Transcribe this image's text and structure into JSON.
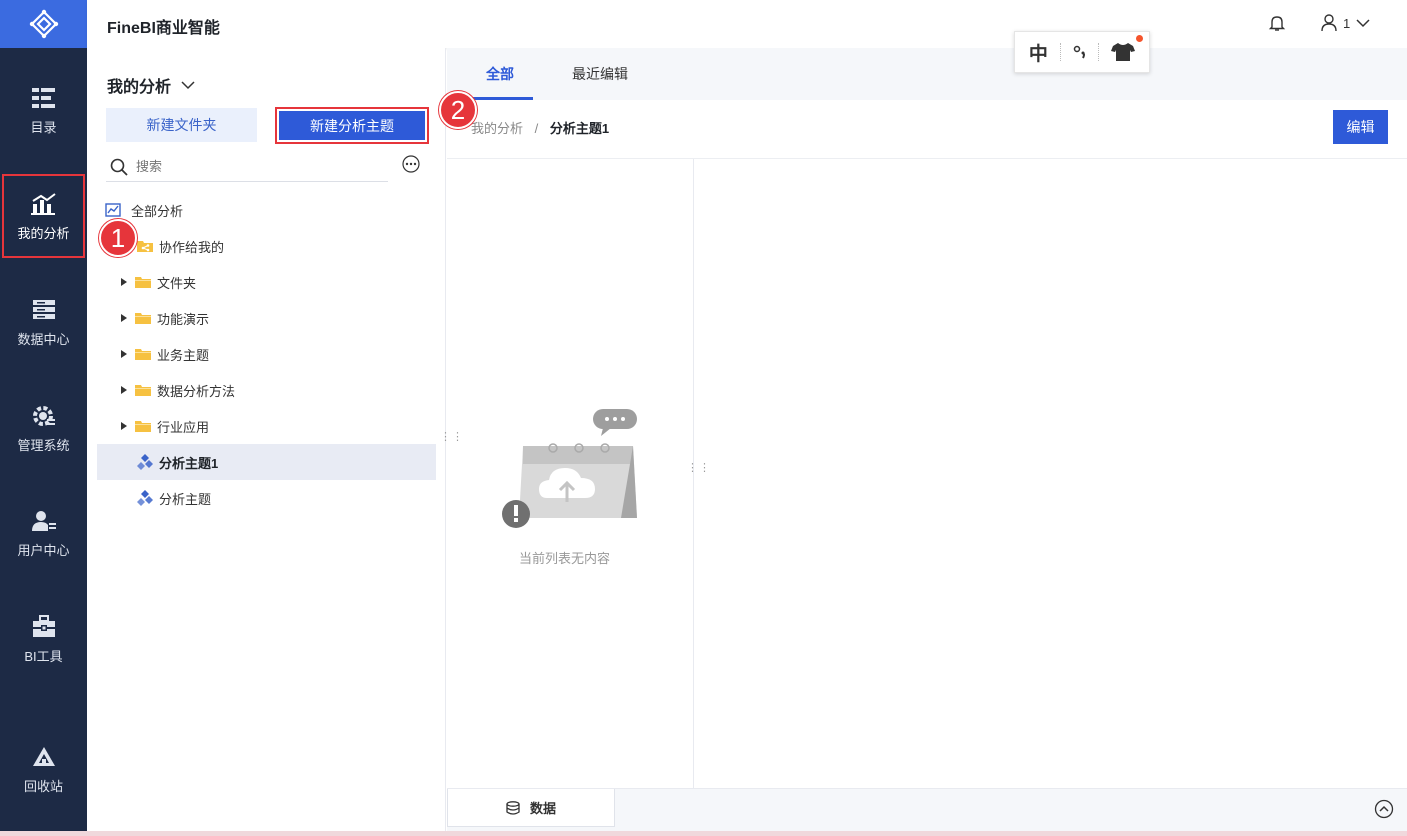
{
  "header": {
    "title": "FineBI商业智能",
    "user": "1"
  },
  "ime": {
    "mode": "中"
  },
  "nav": {
    "items": [
      {
        "label": "目录",
        "icon": "directory-icon"
      },
      {
        "label": "我的分析",
        "icon": "chart-icon"
      },
      {
        "label": "数据中心",
        "icon": "database-icon"
      },
      {
        "label": "管理系统",
        "icon": "gear-icon"
      },
      {
        "label": "用户中心",
        "icon": "user-icon"
      },
      {
        "label": "BI工具",
        "icon": "toolbox-icon"
      },
      {
        "label": "回收站",
        "icon": "recycle-icon"
      }
    ]
  },
  "panel": {
    "title": "我的分析",
    "new_folder": "新建文件夹",
    "new_subject": "新建分析主题",
    "search_placeholder": "搜索",
    "tree": [
      {
        "label": "全部分析"
      },
      {
        "label": "协作给我的"
      },
      {
        "label": "文件夹"
      },
      {
        "label": "功能演示"
      },
      {
        "label": "业务主题"
      },
      {
        "label": "数据分析方法"
      },
      {
        "label": "行业应用"
      },
      {
        "label": "分析主题1"
      },
      {
        "label": "分析主题"
      }
    ]
  },
  "badges": {
    "one": "1",
    "two": "2"
  },
  "tabs": {
    "all": "全部",
    "recent": "最近编辑"
  },
  "breadcrumb": {
    "parent": "我的分析",
    "sep": "/",
    "current": "分析主题1"
  },
  "edit_label": "编辑",
  "empty_text": "当前列表无内容",
  "bottom": {
    "data_tab": "数据"
  }
}
